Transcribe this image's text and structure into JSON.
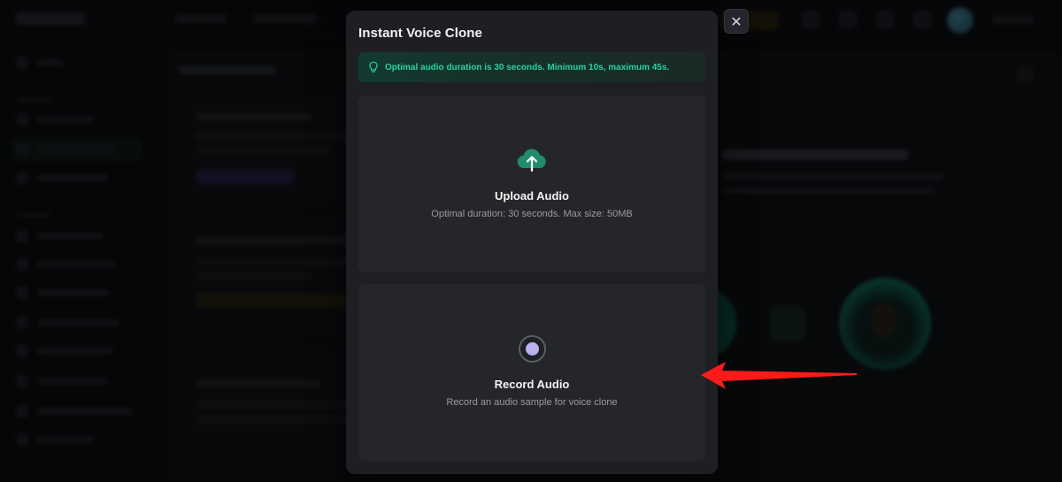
{
  "modal": {
    "title": "Instant Voice Clone",
    "close_symbol": "✕",
    "tip": {
      "icon": "lightbulb-icon",
      "text": "Optimal audio duration is 30 seconds. Minimum 10s, maximum 45s."
    },
    "upload": {
      "icon": "cloud-upload-icon",
      "title": "Upload Audio",
      "subtitle": "Optimal duration: 30 seconds. Max size: 50MB"
    },
    "record": {
      "icon": "record-icon",
      "title": "Record Audio",
      "subtitle": "Record an audio sample for voice clone"
    }
  },
  "colors": {
    "accent": "#22d3a0",
    "arrow": "#ff1a1a",
    "modal_bg": "#1e1f23",
    "panel_bg": "#25262a",
    "record_dot": "#b9b2ee"
  }
}
